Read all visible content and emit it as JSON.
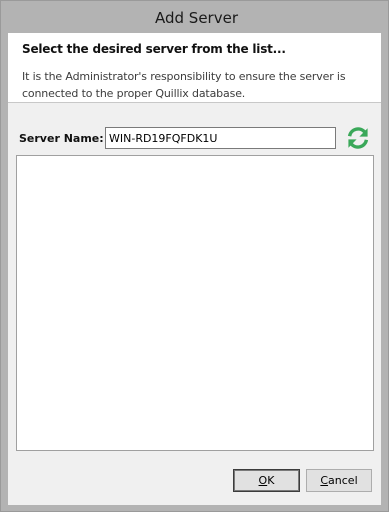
{
  "window": {
    "title": "Add Server"
  },
  "header": {
    "heading": "Select the desired server from the list...",
    "description": "It is the Administrator's responsibility to ensure the server is connected to the proper Quillix database."
  },
  "form": {
    "server_name_label": "Server Name:",
    "server_name_value": "WIN-RD19FQFDK1U",
    "refresh_icon": "refresh-icon"
  },
  "server_list": {
    "items": []
  },
  "buttons": {
    "ok": {
      "mnemonic": "O",
      "rest": "K"
    },
    "cancel": {
      "mnemonic": "C",
      "rest": "ancel"
    }
  },
  "colors": {
    "titlebar": "#b3b3b3",
    "client": "#f0f0f0",
    "refresh_icon": "#3aa859"
  }
}
